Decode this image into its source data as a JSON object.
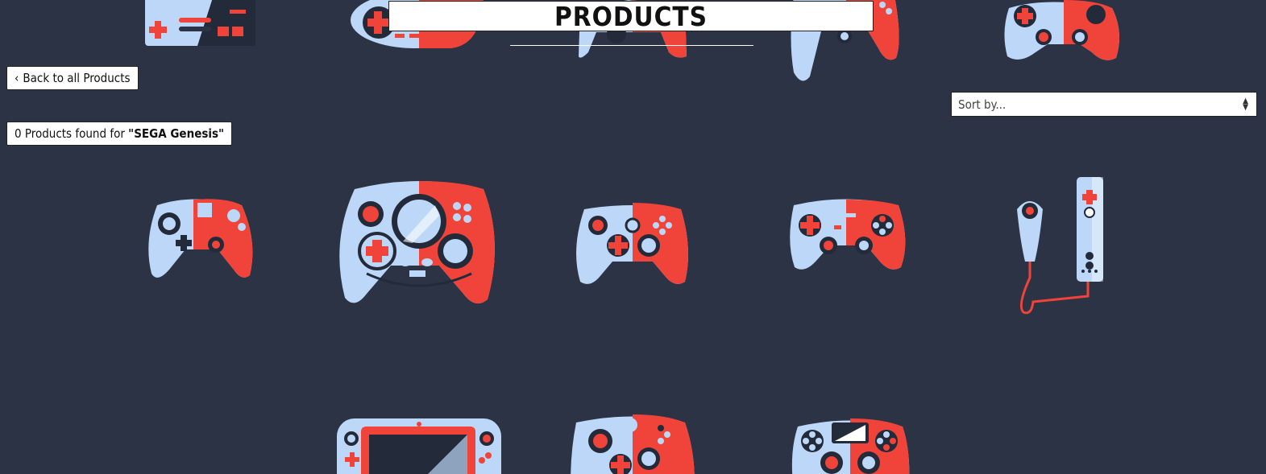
{
  "header": {
    "title": "PRODUCTS"
  },
  "nav": {
    "back_label": "Back to all Products",
    "back_icon": "chevron-left-icon"
  },
  "sort": {
    "placeholder": "Sort by...",
    "icon": "sort-updown-icon"
  },
  "results": {
    "count": "0",
    "text_middle": " Products found for ",
    "query": "\"SEGA Genesis\""
  },
  "colors": {
    "background": "#2b3344",
    "accent_red": "#f0443a",
    "accent_light": "#bcd7f7",
    "dark": "#232b3a"
  },
  "background_art": [
    "nes-controller-icon",
    "snes-controller-icon",
    "n64-controller-icon",
    "ps-controller-icon",
    "gamecube-controller-icon",
    "duke-controller-icon",
    "xbox360-controller-icon",
    "wiimote-nunchuk-icon",
    "wiiu-gamepad-icon",
    "xboxone-controller-icon",
    "ps4-controller-icon"
  ]
}
